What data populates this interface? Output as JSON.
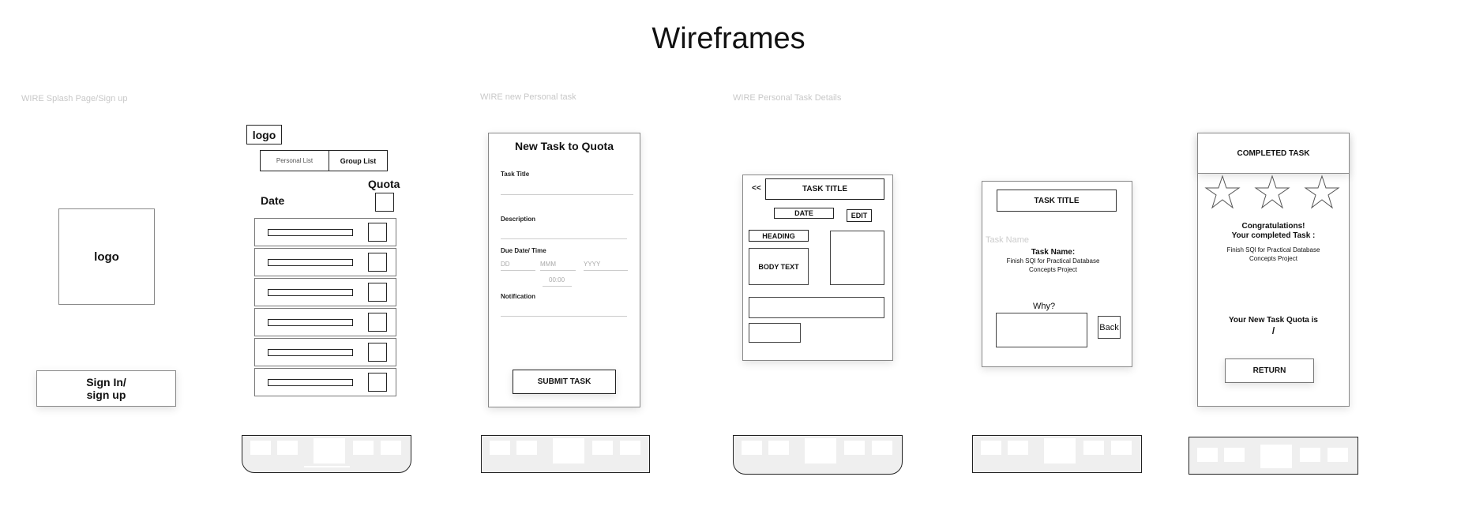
{
  "page": {
    "title": "Wireframes"
  },
  "frames": {
    "splash": {
      "label": "WIRE Splash Page/Sign up",
      "logo": "logo",
      "signin_line1": "Sign In/",
      "signin_line2": "sign up"
    },
    "list": {
      "logo": "logo",
      "tab_personal": "Personal List",
      "tab_group": "Group List",
      "quota_label": "Quota",
      "date_label": "Date",
      "row_count": 6
    },
    "new_task": {
      "label": "WIRE new Personal task",
      "title": "New Task to Quota",
      "task_title_label": "Task Title",
      "description_label": "Description",
      "due_label": "Due Date/ Time",
      "dd": "DD",
      "mmm": "MMM",
      "yyyy": "YYYY",
      "time": "00:00",
      "notification_label": "Notification",
      "submit": "SUBMIT TASK"
    },
    "details": {
      "label": "WIRE Personal Task Details",
      "back": "<<",
      "task_title": "TASK TITLE",
      "date": "DATE",
      "edit": "EDIT",
      "heading": "HEADING",
      "body_text": "BODY TEXT"
    },
    "why": {
      "task_title": "TASK TITLE",
      "task_name_placeholder": "Task Name",
      "task_name_label": "Task Name:",
      "task_name_value_1": "Finish SQl for Practical Database",
      "task_name_value_2": "Concepts Project",
      "why_label": "Why?",
      "back": "Back"
    },
    "completed": {
      "header": "COMPLETED TASK",
      "congrats": "Congratulations!",
      "your_completed": "Your completed Task :",
      "task_line_1": "Finish SQl for Practical Database",
      "task_line_2": "Concepts Project",
      "quota_text": "Your New Task Quota is",
      "quota_value": "/",
      "return": "RETURN",
      "stars": 3
    }
  }
}
